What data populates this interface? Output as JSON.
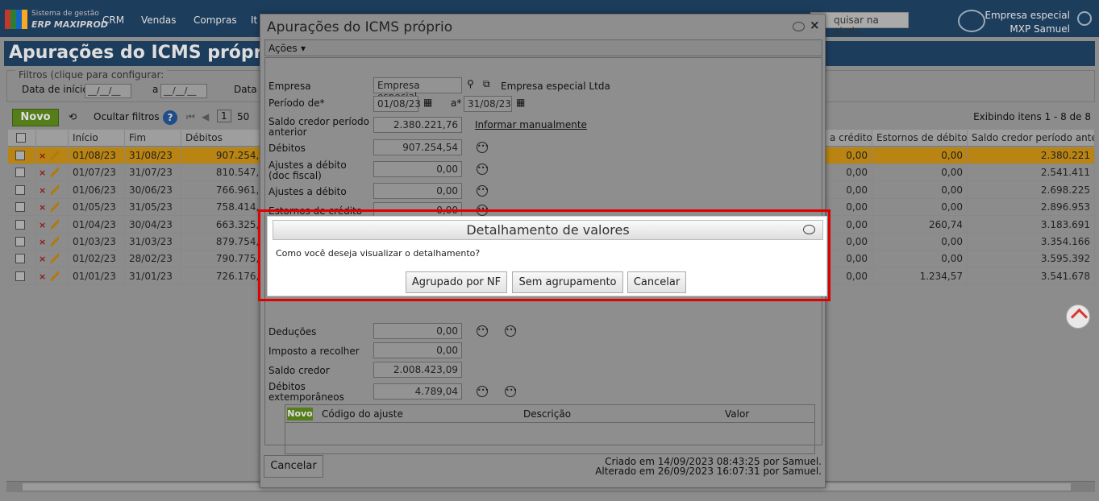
{
  "app": {
    "logo_line1": "Sistema de gestão",
    "logo_line2": "ERP MAXIPROD",
    "menu": [
      "CRM",
      "Vendas",
      "Compras",
      "It"
    ],
    "help_placeholder": "quisar na ajuda...",
    "company": "Empresa especial",
    "user": "MXP Samuel"
  },
  "page": {
    "title": "Apurações do ICMS próprio"
  },
  "filters": {
    "legend": "Filtros (clique para configurar:",
    "start_label": "Data de início",
    "start_value": "__/__/__",
    "a": "a",
    "a_value": "__/__/__",
    "next_label": "Data d"
  },
  "toolbar": {
    "novo": "Novo",
    "hide_filters": "Ocultar filtros",
    "page": "1",
    "per_page": "50",
    "showing": "Exibindo itens 1 - 8 de 8"
  },
  "table": {
    "headers": [
      "Início",
      "Fim",
      "Débitos",
      "a crédito",
      "Estornos de débito",
      "Saldo credor período ante"
    ],
    "rows": [
      {
        "inicio": "01/08/23",
        "fim": "31/08/23",
        "debitos": "907.254,5",
        "acred": "0,00",
        "estornos": "0,00",
        "saldo": "2.380.221"
      },
      {
        "inicio": "01/07/23",
        "fim": "31/07/23",
        "debitos": "810.547,3",
        "acred": "0,00",
        "estornos": "0,00",
        "saldo": "2.541.411"
      },
      {
        "inicio": "01/06/23",
        "fim": "30/06/23",
        "debitos": "766.961,9",
        "acred": "0,00",
        "estornos": "0,00",
        "saldo": "2.698.225"
      },
      {
        "inicio": "01/05/23",
        "fim": "31/05/23",
        "debitos": "758.414,5",
        "acred": "0,00",
        "estornos": "0,00",
        "saldo": "2.896.953"
      },
      {
        "inicio": "01/04/23",
        "fim": "30/04/23",
        "debitos": "663.325,5",
        "acred": "0,00",
        "estornos": "260,74",
        "saldo": "3.183.691"
      },
      {
        "inicio": "01/03/23",
        "fim": "31/03/23",
        "debitos": "879.754,2",
        "acred": "0,00",
        "estornos": "0,00",
        "saldo": "3.354.166"
      },
      {
        "inicio": "01/02/23",
        "fim": "28/02/23",
        "debitos": "790.775,5",
        "acred": "0,00",
        "estornos": "0,00",
        "saldo": "3.595.392"
      },
      {
        "inicio": "01/01/23",
        "fim": "31/01/23",
        "debitos": "726.176,0",
        "acred": "0,00",
        "estornos": "1.234,57",
        "saldo": "3.541.678"
      }
    ]
  },
  "dialog": {
    "title": "Apurações do ICMS próprio",
    "acoes": "Ações",
    "empresa_label": "Empresa",
    "empresa_value": "Empresa especial",
    "empresa_name": "Empresa especial Ltda",
    "periodo_label": "Período de*",
    "periodo_de": "01/08/23",
    "periodo_a_label": "a*",
    "periodo_a": "31/08/23",
    "saldo_ant_label": "Saldo credor período anterior",
    "saldo_ant": "2.380.221,76",
    "informar": "Informar manualmente",
    "debitos_label": "Débitos",
    "debitos": "907.254,54",
    "aj_deb_doc_label": "Ajustes a débito (doc fiscal)",
    "aj_deb_doc": "0,00",
    "aj_deb_label": "Ajustes a débito",
    "aj_deb": "0,00",
    "est_cred_label": "Estornos de crédito",
    "est_cred": "0,00",
    "ded_label": "Deduções",
    "ded": "0,00",
    "imp_label": "Imposto a recolher",
    "imp": "0,00",
    "saldo_cred_label": "Saldo credor",
    "saldo_cred": "2.008.423,09",
    "deb_ext_label": "Débitos extemporâneos",
    "deb_ext": "4.789,04",
    "sub_novo": "Novo",
    "sub_cols": [
      "Código do ajuste",
      "Descrição",
      "Valor"
    ],
    "created": "Criado em 14/09/2023 08:43:25 por Samuel.",
    "altered": "Alterado em 26/09/2023 16:07:31 por Samuel.",
    "cancel": "Cancelar"
  },
  "modal": {
    "title": "Detalhamento de valores",
    "question": "Como você deseja visualizar o detalhamento?",
    "btn_nf": "Agrupado por NF",
    "btn_sem": "Sem agrupamento",
    "btn_cancel": "Cancelar"
  }
}
